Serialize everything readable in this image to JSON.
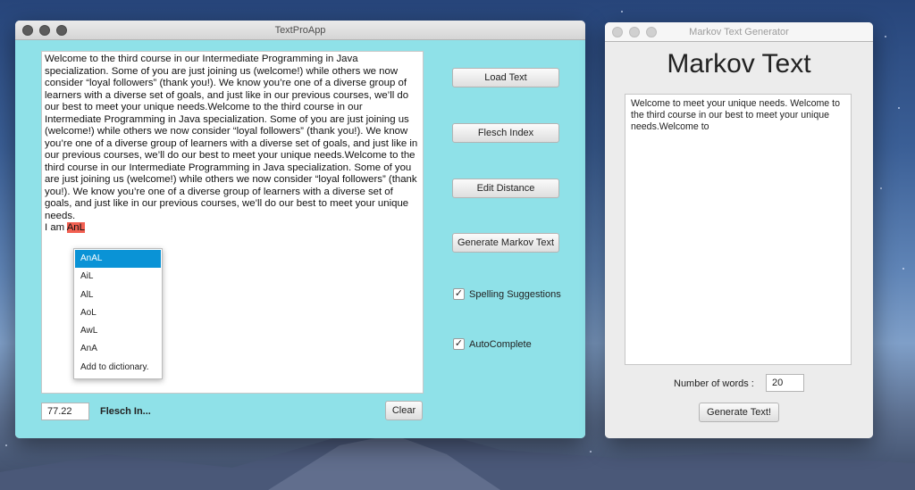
{
  "main_window": {
    "title": "TextProApp",
    "text_content": "Welcome to the third course in our Intermediate Programming in Java specialization. Some of you are just joining us (welcome!) while others we now consider “loyal followers” (thank you!). We know you’re one of a diverse group of learners with a diverse set of goals, and just like in our previous courses, we’ll do our best to meet your unique needs.Welcome to the third course in our Intermediate Programming in Java specialization. Some of you are just joining us (welcome!) while others we now consider “loyal followers” (thank you!). We know you’re one of a diverse group of learners with a diverse set of goals, and just like in our previous courses, we’ll do our best to meet your unique needs.Welcome to the third course in our Intermediate Programming in Java specialization. Some of you are just joining us (welcome!) while others we now consider “loyal followers” (thank you!). We know you’re one of a diverse group of learners with a diverse set of goals, and just like in our previous courses, we’ll do our best to meet your unique needs.",
    "typed_prefix": "I am ",
    "misspelled_word": "AnL",
    "suggestions": [
      "AnAL",
      "AiL",
      "AlL",
      "AoL",
      "AwL",
      "AnA",
      "Add to dictionary."
    ],
    "buttons": {
      "load_text": "Load Text",
      "flesch_index": "Flesch Index",
      "edit_distance": "Edit Distance",
      "generate_markov": "Generate Markov Text",
      "clear": "Clear"
    },
    "checkboxes": {
      "spelling_suggestions": {
        "label": "Spelling Suggestions",
        "checked": true
      },
      "autocomplete": {
        "label": "AutoComplete",
        "checked": true
      }
    },
    "flesch_value": "77.22",
    "flesch_label": "Flesch In..."
  },
  "markov_window": {
    "title": "Markov Text Generator",
    "heading": "Markov Text",
    "generated_text": "Welcome to meet your unique needs. Welcome to the third course in our best to meet your unique needs.Welcome to",
    "num_words_label": "Number of words :",
    "num_words_value": "20",
    "generate_button": "Generate Text!"
  },
  "colors": {
    "main_bg": "#8fe1e8",
    "selection": "#0a93d6",
    "misspelled_highlight": "#f26052"
  }
}
